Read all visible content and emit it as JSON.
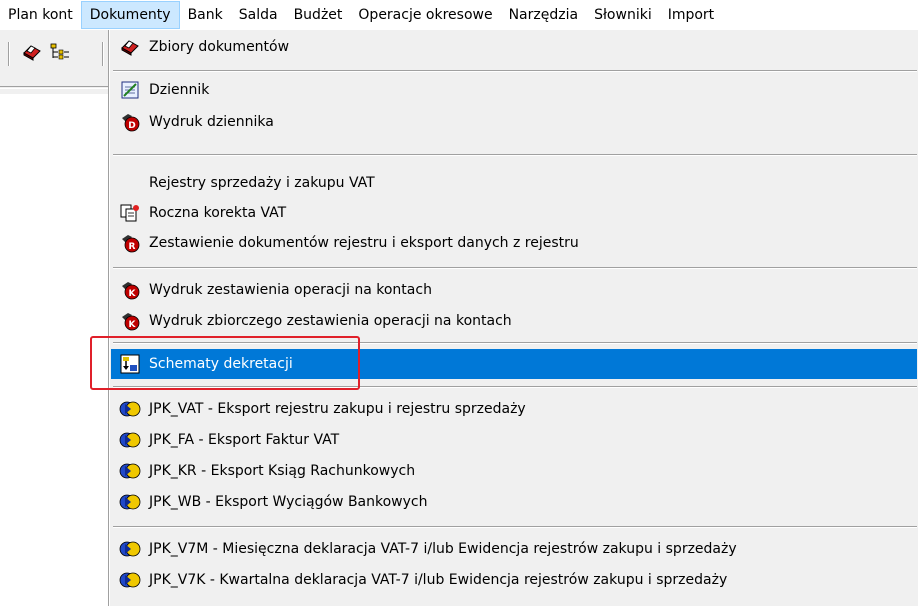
{
  "menubar": {
    "items": [
      {
        "label": "Plan kont"
      },
      {
        "label": "Dokumenty"
      },
      {
        "label": "Bank"
      },
      {
        "label": "Salda"
      },
      {
        "label": "Budżet"
      },
      {
        "label": "Operacje okresowe"
      },
      {
        "label": "Narzędzia"
      },
      {
        "label": "Słowniki"
      },
      {
        "label": "Import"
      }
    ]
  },
  "menu": {
    "items": [
      {
        "label": "Zbiory dokumentów",
        "icon": "eraser-icon"
      },
      {
        "label": "Dziennik",
        "icon": "journal-icon"
      },
      {
        "label": "Wydruk dziennika",
        "icon": "print-d-icon"
      },
      {
        "label": "Rejestry sprzedaży i zakupu VAT",
        "icon": ""
      },
      {
        "label": "Roczna korekta VAT",
        "icon": "vat-correction-icon"
      },
      {
        "label": "Zestawienie dokumentów rejestru i eksport danych z rejestru",
        "icon": "print-r-icon"
      },
      {
        "label": "Wydruk zestawienia operacji na kontach",
        "icon": "print-k-icon"
      },
      {
        "label": "Wydruk zbiorczego zestawienia operacji na kontach",
        "icon": "print-k-icon"
      },
      {
        "label": "Schematy dekretacji",
        "icon": "scheme-icon"
      },
      {
        "label": "JPK_VAT - Eksport rejestru zakupu i rejestru sprzedaży",
        "icon": "jpk-icon"
      },
      {
        "label": "JPK_FA - Eksport Faktur VAT",
        "icon": "jpk-icon"
      },
      {
        "label": "JPK_KR - Eksport Ksiąg Rachunkowych",
        "icon": "jpk-icon"
      },
      {
        "label": "JPK_WB - Eksport Wyciągów Bankowych",
        "icon": "jpk-icon"
      },
      {
        "label": "JPK_V7M - Miesięczna deklaracja VAT-7 i/lub Ewidencja rejestrów zakupu i sprzedaży",
        "icon": "jpk-icon"
      },
      {
        "label": "JPK_V7K - Kwartalna deklaracja VAT-7 i/lub Ewidencja rejestrów zakupu i sprzedaży",
        "icon": "jpk-icon"
      }
    ]
  },
  "colors": {
    "selection": "#0078d7",
    "menu_bg": "#f0f0f0",
    "highlight_box": "#e0202a",
    "active_menu": "#cce8ff"
  }
}
